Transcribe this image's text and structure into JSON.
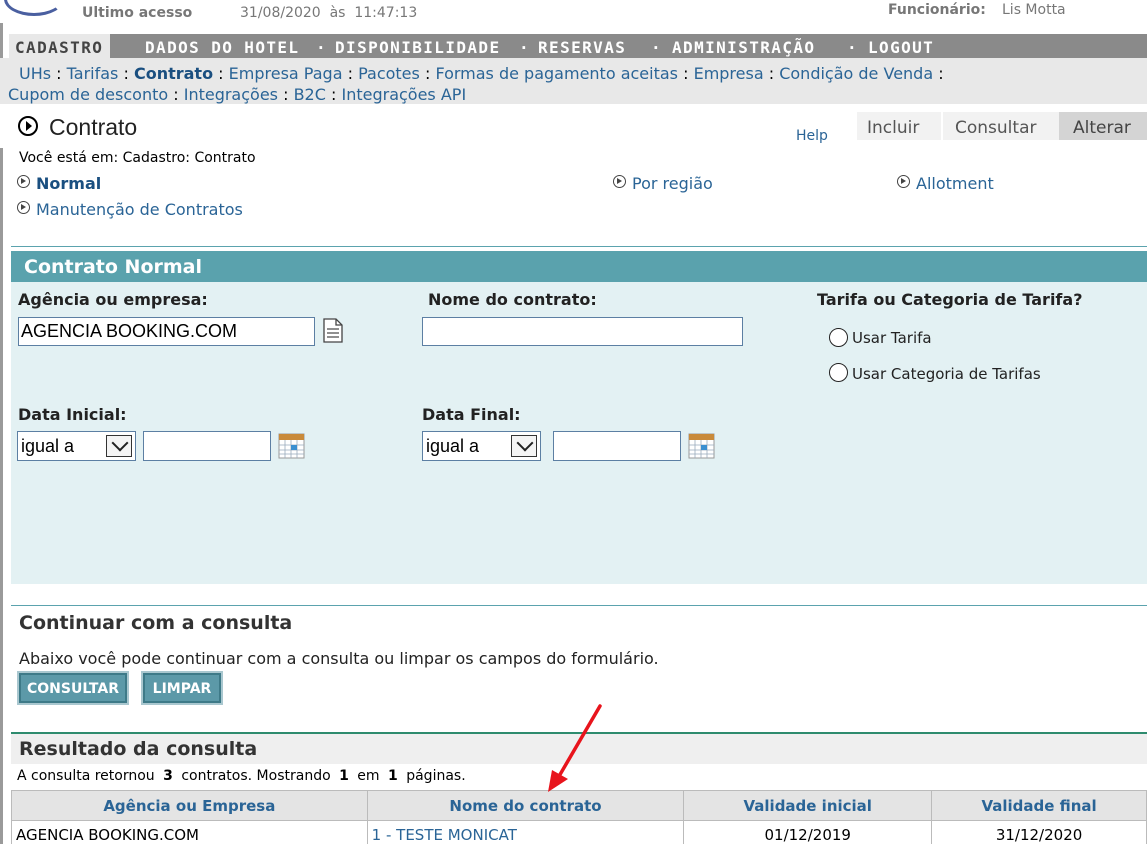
{
  "header": {
    "last_access_label": "Ultimo acesso",
    "last_access_value": "31/08/2020  às  11:47:13",
    "employee_label": "Funcionário:",
    "employee_value": "Lis Motta"
  },
  "main_nav": {
    "items": [
      {
        "label": "CADASTRO"
      },
      {
        "label": "DADOS DO HOTEL"
      },
      {
        "label": "DISPONIBILIDADE"
      },
      {
        "label": "RESERVAS"
      },
      {
        "label": "ADMINISTRAÇÃO"
      },
      {
        "label": "LOGOUT"
      }
    ],
    "separator": "·"
  },
  "sub_nav": {
    "items": [
      {
        "label": "UHs"
      },
      {
        "label": "Tarifas"
      },
      {
        "label": "Contrato"
      },
      {
        "label": "Empresa Paga"
      },
      {
        "label": "Pacotes"
      },
      {
        "label": "Formas de pagamento aceitas"
      },
      {
        "label": "Empresa"
      },
      {
        "label": "Condição de Venda"
      },
      {
        "label": "Cupom de desconto"
      },
      {
        "label": "Integrações"
      },
      {
        "label": "B2C"
      },
      {
        "label": "Integrações API"
      }
    ],
    "separator": ":"
  },
  "page": {
    "title": "Contrato",
    "help": "Help",
    "tabs": {
      "incluir": "Incluir",
      "consultar": "Consultar",
      "alterar": "Alterar"
    },
    "breadcrumb": "Você está em: Cadastro: Contrato",
    "options": {
      "normal": "Normal",
      "regiao": "Por região",
      "allotment": "Allotment",
      "manutencao": "Manutenção de Contratos"
    }
  },
  "form": {
    "title": "Contrato Normal",
    "agencia_label": "Agência ou empresa:",
    "agencia_value": "AGENCIA BOOKING.COM",
    "nome_label": "Nome do contrato:",
    "nome_value": "",
    "tarifa_label": "Tarifa ou Categoria de Tarifa?",
    "radio_tarifa": "Usar Tarifa",
    "radio_categoria": "Usar Categoria de Tarifas",
    "data_inicial_label": "Data Inicial:",
    "data_inicial_op": "igual a",
    "data_inicial_value": "",
    "data_final_label": "Data Final:",
    "data_final_op": "igual a",
    "data_final_value": ""
  },
  "continue": {
    "title": "Continuar com a consulta",
    "description": "Abaixo você pode continuar com a consulta ou limpar os campos do formulário.",
    "btn_consultar": "CONSULTAR",
    "btn_limpar": "LIMPAR"
  },
  "results": {
    "title": "Resultado da consulta",
    "summary_pre": "A consulta retornou",
    "count": "3",
    "summary_mid": "contratos. Mostrando",
    "page_current": "1",
    "summary_em": "em",
    "page_total": "1",
    "summary_post": "páginas.",
    "columns": [
      "Agência ou Empresa",
      "Nome do contrato",
      "Validade inicial",
      "Validade final"
    ],
    "rows": [
      [
        "AGENCIA BOOKING.COM",
        "1 - TESTE MONICAT",
        "01/12/2019",
        "31/12/2020"
      ]
    ]
  },
  "colors": {
    "accent": "#5aa2ad",
    "link": "#2a6496",
    "annotation_arrow": "#e8141c"
  }
}
